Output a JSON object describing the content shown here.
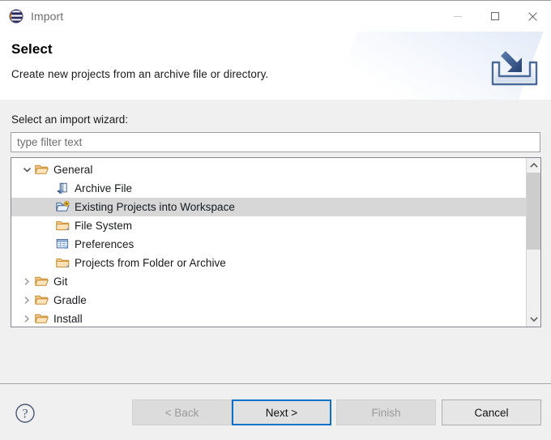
{
  "window": {
    "title": "Import",
    "app_icon": "eclipse-logo-icon",
    "controls": {
      "minimize": {
        "name": "minimize-icon",
        "label": "Minimize",
        "enabled": false
      },
      "maximize": {
        "name": "maximize-icon",
        "label": "Maximize",
        "enabled": true
      },
      "close": {
        "name": "close-icon",
        "label": "Close",
        "enabled": true
      }
    }
  },
  "header": {
    "title": "Select",
    "description": "Create new projects from an archive file or directory.",
    "banner_icon": "import-tray-arrow-icon"
  },
  "main": {
    "wizard_label": "Select an import wizard:",
    "filter": {
      "placeholder": "type filter text",
      "value": ""
    },
    "tree": [
      {
        "label": "General",
        "level": 0,
        "icon": "folder-open-icon",
        "expanded": true,
        "twisty": "chevron-down-icon",
        "selected": false
      },
      {
        "label": "Archive File",
        "level": 1,
        "icon": "archive-file-icon",
        "expanded": null,
        "twisty": "none",
        "selected": false
      },
      {
        "label": "Existing Projects into Workspace",
        "level": 1,
        "icon": "import-project-folder-icon",
        "expanded": null,
        "twisty": "none",
        "selected": true
      },
      {
        "label": "File System",
        "level": 1,
        "icon": "folder-icon",
        "expanded": null,
        "twisty": "none",
        "selected": false
      },
      {
        "label": "Preferences",
        "level": 1,
        "icon": "preferences-grid-icon",
        "expanded": null,
        "twisty": "none",
        "selected": false
      },
      {
        "label": "Projects from Folder or Archive",
        "level": 1,
        "icon": "folder-icon",
        "expanded": null,
        "twisty": "none",
        "selected": false
      },
      {
        "label": "Git",
        "level": 0,
        "icon": "folder-open-icon",
        "expanded": false,
        "twisty": "chevron-right-icon",
        "selected": false
      },
      {
        "label": "Gradle",
        "level": 0,
        "icon": "folder-open-icon",
        "expanded": false,
        "twisty": "chevron-right-icon",
        "selected": false
      },
      {
        "label": "Install",
        "level": 0,
        "icon": "folder-open-icon",
        "expanded": false,
        "twisty": "chevron-right-icon",
        "selected": false
      }
    ],
    "scrollbar": {
      "up_icon": "chevron-up-icon",
      "down_icon": "chevron-down-icon",
      "thumb_top_pct": 0,
      "thumb_height_pct": 55
    }
  },
  "footer": {
    "help": {
      "name": "help-question-icon",
      "label": "Help"
    },
    "buttons": [
      {
        "key": "back",
        "label": "< Back",
        "enabled": false,
        "default": false
      },
      {
        "key": "next",
        "label": "Next >",
        "enabled": true,
        "default": true
      },
      {
        "key": "finish",
        "label": "Finish",
        "enabled": false,
        "default": false
      },
      {
        "key": "cancel",
        "label": "Cancel",
        "enabled": true,
        "default": false
      }
    ]
  },
  "colors": {
    "accent": "#0a71c8",
    "body_bg": "#f0f0f0",
    "selection": "#d7d7d7",
    "folder": "#e8a33d",
    "help": "#4a5a75"
  }
}
